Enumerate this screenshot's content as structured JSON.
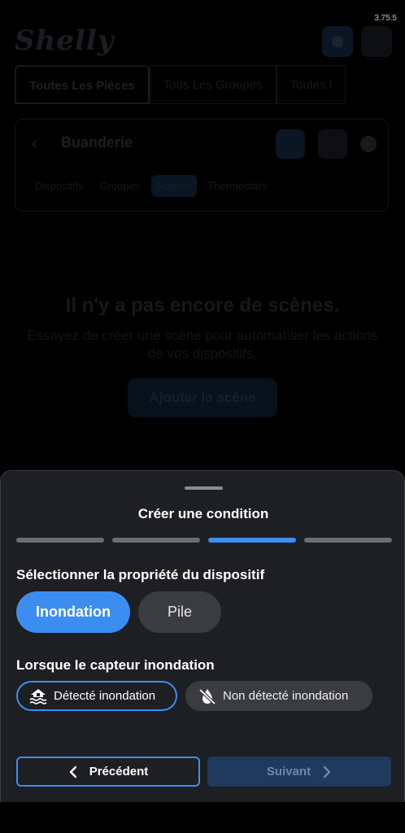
{
  "version": "3.75.5",
  "app": {
    "logo": "Shelly"
  },
  "room_tabs": [
    "Toutes Les Pièces",
    "Tous Les Groupes",
    "Toutes l"
  ],
  "room": {
    "name": "Buanderie",
    "subtabs": [
      "Dispositifs",
      "Groupes",
      "Scènes",
      "Thermostats"
    ]
  },
  "empty": {
    "title": "Il n'y a pas encore de scènes.",
    "subtitle": "Essayez de créer une scène pour automatiser les actions de vos dispositifs.",
    "button": "Ajouter la scène"
  },
  "sheet": {
    "title": "Créer une condition",
    "steps_total": 4,
    "step_active": 3,
    "section1_label": "Sélectionner la propriété du dispositif",
    "properties": [
      "Inondation",
      "Pile"
    ],
    "selected_property": "Inondation",
    "section2_label": "Lorsque le capteur inondation",
    "conditions": [
      "Détecté inondation",
      "Non détecté inondation"
    ],
    "selected_condition": "Détecté inondation",
    "prev_label": "Précédent",
    "next_label": "Suivant"
  },
  "colors": {
    "accent": "#3b8ef0",
    "sheet_bg": "#1d1f23",
    "chip_bg": "#3a3c40",
    "next_disabled_bg": "#1f3a5c"
  }
}
